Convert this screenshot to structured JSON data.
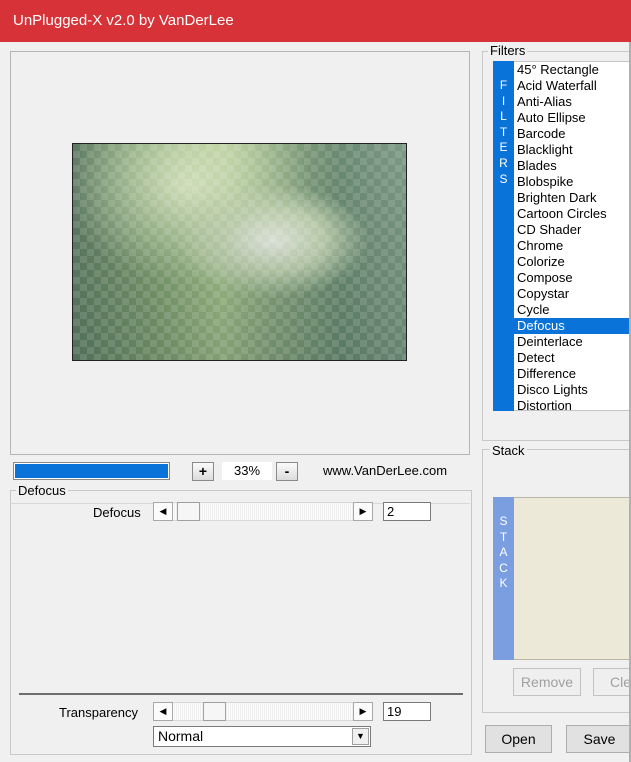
{
  "window": {
    "title": "UnPlugged-X v2.0 by VanDerLee"
  },
  "preview": {
    "progress": 1.0,
    "zoom_in_label": "+",
    "zoom_out_label": "-",
    "zoom": "33%",
    "website": "www.VanDerLee.com"
  },
  "parameters": {
    "group_label": "Defocus",
    "defocus": {
      "label": "Defocus",
      "value": "2",
      "left_arrow": "◀",
      "right_arrow": "▶"
    },
    "transparency": {
      "label": "Transparency",
      "value": "19",
      "left_arrow": "◀",
      "right_arrow": "▶"
    },
    "blend_mode": "Normal",
    "dropdown_arrow": "▼"
  },
  "filters": {
    "group_label": "Filters",
    "tab_letters": [
      "F",
      "I",
      "L",
      "T",
      "E",
      "R",
      "S"
    ],
    "items": [
      "45° Rectangle",
      "Acid Waterfall",
      "Anti-Alias",
      "Auto Ellipse",
      "Barcode",
      "Blacklight",
      "Blades",
      "Blobspike",
      "Brighten Dark",
      "Cartoon Circles",
      "CD Shader",
      "Chrome",
      "Colorize",
      "Compose",
      "Copystar",
      "Cycle",
      "Defocus",
      "Deinterlace",
      "Detect",
      "Difference",
      "Disco Lights",
      "Distortion"
    ],
    "selected": "Defocus"
  },
  "stack": {
    "group_label": "Stack",
    "tab_letters": [
      "S",
      "T",
      "A",
      "C",
      "K"
    ],
    "remove_label": "Remove",
    "clear_label": "Cle"
  },
  "buttons": {
    "open_label": "Open",
    "save_label": "Save"
  },
  "colors": {
    "titlebar": "#d63238",
    "selection": "#0a73d9",
    "stack_tab": "#7b9ee0"
  }
}
